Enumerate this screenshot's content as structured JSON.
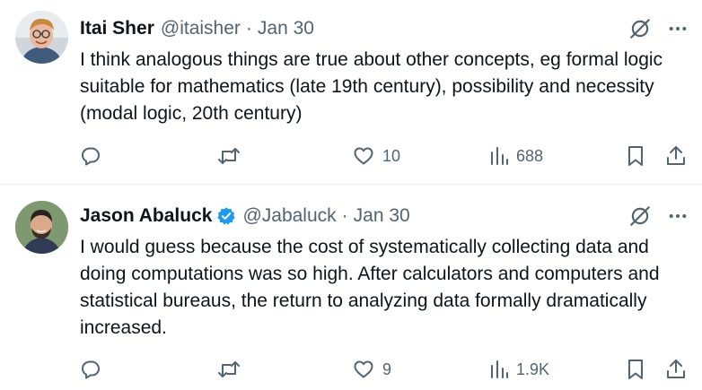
{
  "tweets": [
    {
      "author_name": "Itai Sher",
      "handle": "@itaisher",
      "separator": "·",
      "date": "Jan 30",
      "verified": false,
      "text": "I think analogous things are true about other concepts, eg formal logic suitable for mathematics (late 19th century), possibility and necessity (modal logic, 20th century)",
      "likes": "10",
      "views": "688",
      "icons": [
        "grok-icon",
        "more-icon",
        "reply-icon",
        "retweet-icon",
        "like-icon",
        "views-icon",
        "bookmark-icon",
        "share-icon"
      ]
    },
    {
      "author_name": "Jason Abaluck",
      "handle": "@Jabaluck",
      "separator": "·",
      "date": "Jan 30",
      "verified": true,
      "text": "I would guess because the cost of systematically collecting data and doing computations was so high. After calculators and computers and statistical bureaus, the return to analyzing data formally dramatically increased.",
      "likes": "9",
      "views": "1.9K",
      "icons": [
        "grok-icon",
        "more-icon",
        "reply-icon",
        "retweet-icon",
        "like-icon",
        "views-icon",
        "bookmark-icon",
        "share-icon"
      ]
    }
  ],
  "colors": {
    "text": "#0f1419",
    "secondary": "#536471",
    "verified_blue": "#1d9bf0",
    "divider": "#eff3f4"
  }
}
